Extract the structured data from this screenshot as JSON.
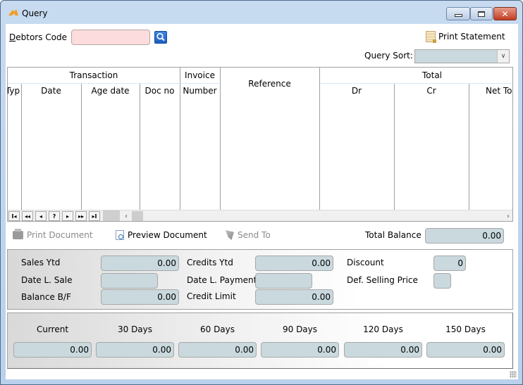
{
  "window": {
    "title": "Query",
    "app_icon": "kangaroo-logo-icon",
    "controls": {
      "minimize": "minimize-icon",
      "maximize": "maximize-icon",
      "close": "close-icon"
    }
  },
  "header": {
    "debtors_code_label": "Debtors Code",
    "debtors_code_value": "",
    "search_icon": "magnifier-icon",
    "print_statement_label": "Print Statement",
    "query_sort_label": "Query Sort:",
    "query_sort_value": ""
  },
  "grid": {
    "group_headers": [
      {
        "label": "Transaction"
      },
      {
        "label": "Invoice"
      },
      {
        "label": "Total"
      }
    ],
    "columns": [
      {
        "label": "Typ"
      },
      {
        "label": "Date"
      },
      {
        "label": "Age date"
      },
      {
        "label": "Doc no"
      },
      {
        "label": "Number"
      },
      {
        "label": "Reference"
      },
      {
        "label": "Dr"
      },
      {
        "label": "Cr"
      },
      {
        "label": "Net To"
      }
    ],
    "rows": [],
    "nav_buttons": [
      {
        "glyph": "I◂",
        "name": "first-record-button"
      },
      {
        "glyph": "◂◂",
        "name": "prev-page-button"
      },
      {
        "glyph": "◂",
        "name": "prev-record-button"
      },
      {
        "glyph": "?",
        "name": "find-record-button"
      },
      {
        "glyph": "▸",
        "name": "next-record-button"
      },
      {
        "glyph": "▸▸",
        "name": "next-page-button"
      },
      {
        "glyph": "▸I",
        "name": "last-record-button"
      }
    ],
    "scroll_left": "‹",
    "scroll_right": "›"
  },
  "actions": {
    "print_document": "Print Document",
    "preview_document": "Preview Document",
    "send_to": "Send To",
    "total_balance_label": "Total Balance",
    "total_balance_value": "0.00"
  },
  "summary": {
    "sales_ytd_label": "Sales Ytd",
    "sales_ytd_value": "0.00",
    "date_last_sale_label": "Date L. Sale",
    "date_last_sale_value": "",
    "balance_bf_label": "Balance B/F",
    "balance_bf_value": "0.00",
    "credits_ytd_label": "Credits Ytd",
    "credits_ytd_value": "0.00",
    "date_last_payment_label": "Date L. Payment",
    "date_last_payment_value": "",
    "credit_limit_label": "Credit Limit",
    "credit_limit_value": "0.00",
    "discount_label": "Discount",
    "discount_value": "0",
    "def_selling_price_label": "Def. Selling Price",
    "def_selling_price_value": ""
  },
  "aging": [
    {
      "label": "Current",
      "value": "0.00"
    },
    {
      "label": "30 Days",
      "value": "0.00"
    },
    {
      "label": "60 Days",
      "value": "0.00"
    },
    {
      "label": "90 Days",
      "value": "0.00"
    },
    {
      "label": "120 Days",
      "value": "0.00"
    },
    {
      "label": "150 Days",
      "value": "0.00"
    }
  ]
}
